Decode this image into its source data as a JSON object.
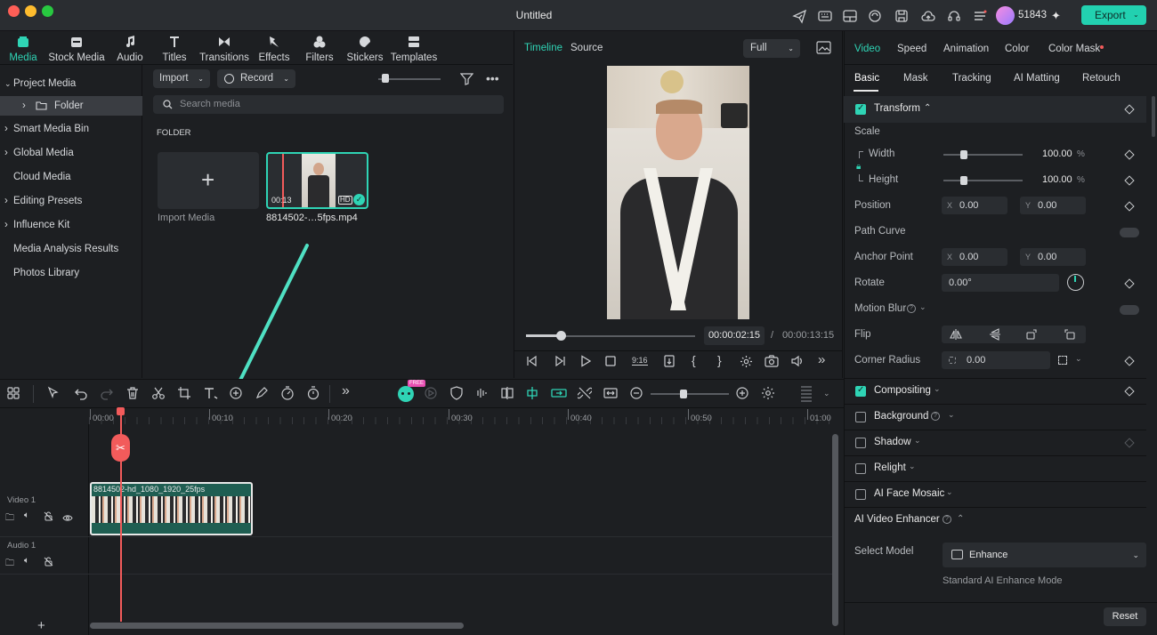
{
  "window": {
    "title": "Untitled",
    "credits": "51843",
    "export_label": "Export"
  },
  "media_tabs": [
    {
      "label": "Media",
      "active": true
    },
    {
      "label": "Stock Media"
    },
    {
      "label": "Audio"
    },
    {
      "label": "Titles"
    },
    {
      "label": "Transitions"
    },
    {
      "label": "Effects"
    },
    {
      "label": "Filters"
    },
    {
      "label": "Stickers"
    },
    {
      "label": "Templates"
    }
  ],
  "tree": [
    {
      "label": "Project Media",
      "expanded": true
    },
    {
      "label": "Folder",
      "selected": true
    },
    {
      "label": "Smart Media Bin"
    },
    {
      "label": "Global Media"
    },
    {
      "label": "Cloud Media"
    },
    {
      "label": "Editing Presets"
    },
    {
      "label": "Influence Kit"
    },
    {
      "label": "Media Analysis Results"
    },
    {
      "label": "Photos Library"
    }
  ],
  "media": {
    "import_label": "Import",
    "record_label": "Record",
    "search_placeholder": "Search media",
    "folder_label": "FOLDER",
    "import_media_label": "Import Media",
    "clip_name": "8814502-…5fps.mp4",
    "clip_duration": "00:13"
  },
  "preview": {
    "tab_timeline": "Timeline",
    "tab_source": "Source",
    "zoom": "Full",
    "current_time": "00:00:02:15",
    "separator": "/",
    "total_time": "00:00:13:15",
    "progress": 0.2
  },
  "props": {
    "tabs": [
      "Video",
      "Speed",
      "Animation",
      "Color",
      "Color Mask"
    ],
    "subtabs": [
      "Basic",
      "Mask",
      "Tracking",
      "AI Matting",
      "Retouch"
    ],
    "transform": "Transform",
    "scale": "Scale",
    "width_label": "Width",
    "width_value": "100.00",
    "height_label": "Height",
    "height_value": "100.00",
    "percent": "%",
    "position": "Position",
    "x_label": "X",
    "y_label": "Y",
    "pos_x": "0.00",
    "pos_y": "0.00",
    "path_curve": "Path Curve",
    "anchor_point": "Anchor Point",
    "anchor_x": "0.00",
    "anchor_y": "0.00",
    "rotate": "Rotate",
    "rotate_value": "0.00°",
    "motion_blur": "Motion Blur",
    "flip": "Flip",
    "corner_radius": "Corner Radius",
    "corner_value": "0.00",
    "compositing": "Compositing",
    "background": "Background",
    "shadow": "Shadow",
    "relight": "Relight",
    "ai_face_mosaic": "AI Face Mosaic",
    "ai_video_enhancer": "AI Video Enhancer",
    "select_model": "Select Model",
    "model_value": "Enhance",
    "model_desc": "Standard AI Enhance Mode",
    "reset": "Reset"
  },
  "timeline": {
    "ticks": [
      "00:00",
      "00:10",
      "00:20",
      "00:30",
      "00:40",
      "00:50",
      "01:00"
    ],
    "badge": "FREE",
    "track_video": "Video 1",
    "track_audio": "Audio 1",
    "clip_label": "8814502-hd_1080_1920_25fps"
  },
  "colors": {
    "accent": "#2fd4b5",
    "playhead": "#f25b5b",
    "export": "#22d1b0"
  }
}
